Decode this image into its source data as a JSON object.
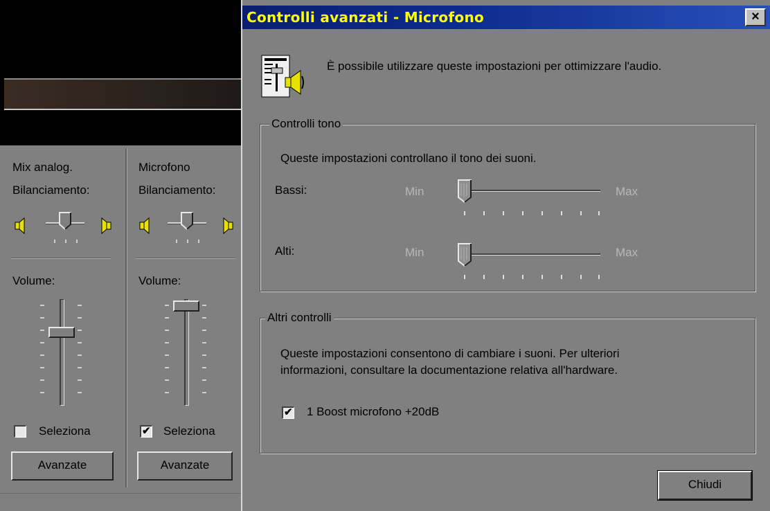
{
  "mixer": {
    "columns": [
      {
        "name": "Mix analog.",
        "balance_label": "Bilanciamento:",
        "volume_label": "Volume:",
        "select_label": "Seleziona",
        "select_checked": false,
        "advanced_label": "Avanzate"
      },
      {
        "name": "Microfono",
        "balance_label": "Bilanciamento:",
        "volume_label": "Volume:",
        "select_label": "Seleziona",
        "select_checked": true,
        "advanced_label": "Avanzate"
      }
    ]
  },
  "dialog": {
    "title": "Controlli avanzati - Microfono",
    "close_glyph": "×",
    "intro": "È possibile utilizzare queste impostazioni per ottimizzare l'audio.",
    "tone_group": {
      "title": "Controlli tono",
      "description": "Queste impostazioni controllano il tono dei suoni.",
      "bass_label": "Bassi:",
      "treble_label": "Alti:",
      "min_label": "Min",
      "max_label": "Max",
      "bass_level": 0,
      "treble_level": 0
    },
    "other_group": {
      "title": "Altri controlli",
      "description_line1": "Queste impostazioni consentono di cambiare i suoni. Per ulteriori",
      "description_line2": "informazioni, consultare la documentazione relativa all'hardware.",
      "boost_label": "1  Boost microfono +20dB",
      "boost_checked": true
    },
    "close_button_label": "Chiudi"
  },
  "colors": {
    "titlebar": "#0c2a8e",
    "title_text": "#ffff00",
    "window_bg": "#808080",
    "disabled_text": "#b8b8b8"
  },
  "icons": [
    "speaker-left-icon",
    "speaker-right-icon",
    "audio-settings-icon",
    "close-icon",
    "checkmark-icon"
  ]
}
